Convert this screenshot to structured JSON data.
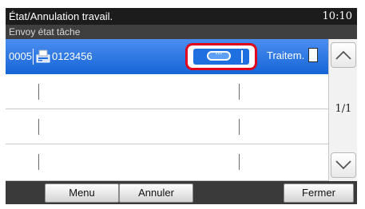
{
  "header": {
    "title": "État/Annulation travail.",
    "time": "10:10"
  },
  "subheader": {
    "label": "Envoy état tâche"
  },
  "jobs": [
    {
      "number": "0005",
      "type_icon": "fax-icon",
      "destination": "0123456",
      "detail_icon": "ellipsis-icon",
      "status": "Traitem.",
      "status_icon": "document-icon",
      "selected": true
    }
  ],
  "scrollbar": {
    "up_icon": "chevron-up-icon",
    "down_icon": "chevron-down-icon",
    "page_indicator": "1/1"
  },
  "footer": {
    "menu_label": "Menu",
    "cancel_label": "Annuler",
    "close_label": "Fermer"
  },
  "colors": {
    "selected_row": "#1e70e0",
    "highlight": "#e0001b",
    "titlebar": "#1c1c1c",
    "footer": "#3a3a3a"
  }
}
